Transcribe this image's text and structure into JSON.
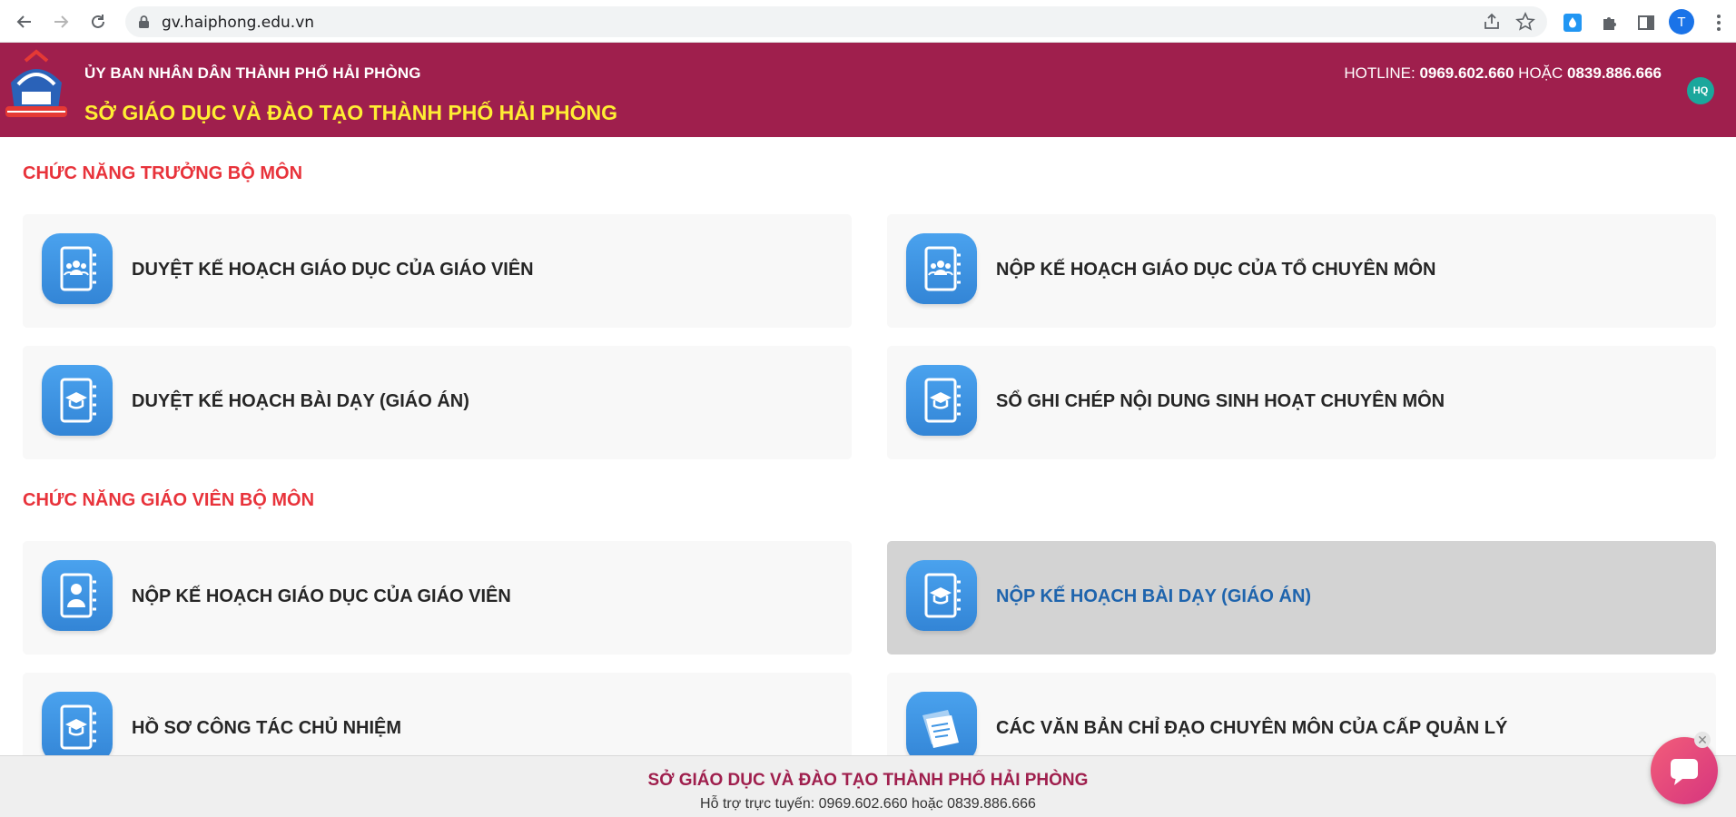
{
  "browser": {
    "url": "gv.haiphong.edu.vn",
    "profile_initial": "T"
  },
  "header": {
    "org_top": "ỦY BAN NHÂN DÂN THÀNH PHỐ HẢI PHÒNG",
    "org_main": "SỞ GIÁO DỤC VÀ ĐÀO TẠO THÀNH PHỐ HẢI PHÒNG",
    "hotline_label": "HOTLINE: ",
    "hotline_1": "0969.602.660",
    "hotline_or": " HOẶC ",
    "hotline_2": "0839.886.666",
    "user_initials": "HQ"
  },
  "sections": [
    {
      "title": "CHỨC NĂNG TRƯỞNG BỘ MÔN",
      "items": [
        {
          "label": "DUYỆT KẾ HOẠCH GIÁO DỤC CỦA GIÁO VIÊN",
          "icon": "group-notebook-icon"
        },
        {
          "label": "NỘP KẾ HOẠCH GIÁO DỤC CỦA TỔ CHUYÊN MÔN",
          "icon": "group-notebook-icon"
        },
        {
          "label": "DUYỆT KẾ HOẠCH BÀI DẠY (GIÁO ÁN)",
          "icon": "graduation-notebook-icon"
        },
        {
          "label": "SỔ GHI CHÉP NỘI DUNG SINH HOẠT CHUYÊN MÔN",
          "icon": "graduation-notebook-icon"
        }
      ]
    },
    {
      "title": "CHỨC NĂNG GIÁO VIÊN BỘ MÔN",
      "items": [
        {
          "label": "NỘP KẾ HOẠCH GIÁO DỤC CỦA GIÁO VIÊN",
          "icon": "person-notebook-icon"
        },
        {
          "label": "NỘP KẾ HOẠCH BÀI DẠY (GIÁO ÁN)",
          "icon": "graduation-notebook-icon"
        },
        {
          "label": "HỒ SƠ CÔNG TÁC CHỦ NHIỆM",
          "icon": "graduation-notebook-icon"
        },
        {
          "label": "CÁC VĂN BẢN CHỈ ĐẠO CHUYÊN MÔN CỦA CẤP QUẢN LÝ",
          "icon": "documents-icon"
        }
      ]
    }
  ],
  "footer": {
    "title": "SỞ GIÁO DỤC VÀ ĐÀO TẠO THÀNH PHỐ HẢI PHÒNG",
    "support": "Hỗ trợ trực tuyến: 0969.602.660 hoặc 0839.886.666"
  },
  "colors": {
    "header_bg": "#9f1f4d",
    "header_title": "#ffee33",
    "section_title": "#e8333b",
    "icon_blue": "#3d94e4",
    "active_label": "#1e64ad"
  }
}
